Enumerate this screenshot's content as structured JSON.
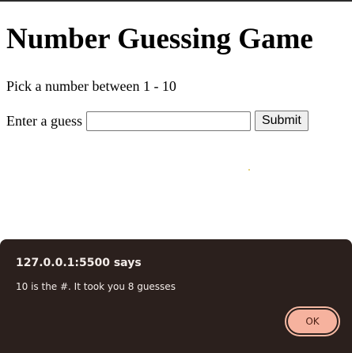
{
  "page": {
    "title": "Number Guessing Game",
    "instructions": "Pick a number between 1 - 10",
    "guess_label": "Enter a guess",
    "guess_value": "",
    "submit_label": "Submit"
  },
  "dialog": {
    "title": "127.0.0.1:5500 says",
    "message": "10 is the #. It took you 8 guesses",
    "ok_label": "OK",
    "colors": {
      "background": "#2b201d",
      "button": "#f6b29e"
    }
  }
}
